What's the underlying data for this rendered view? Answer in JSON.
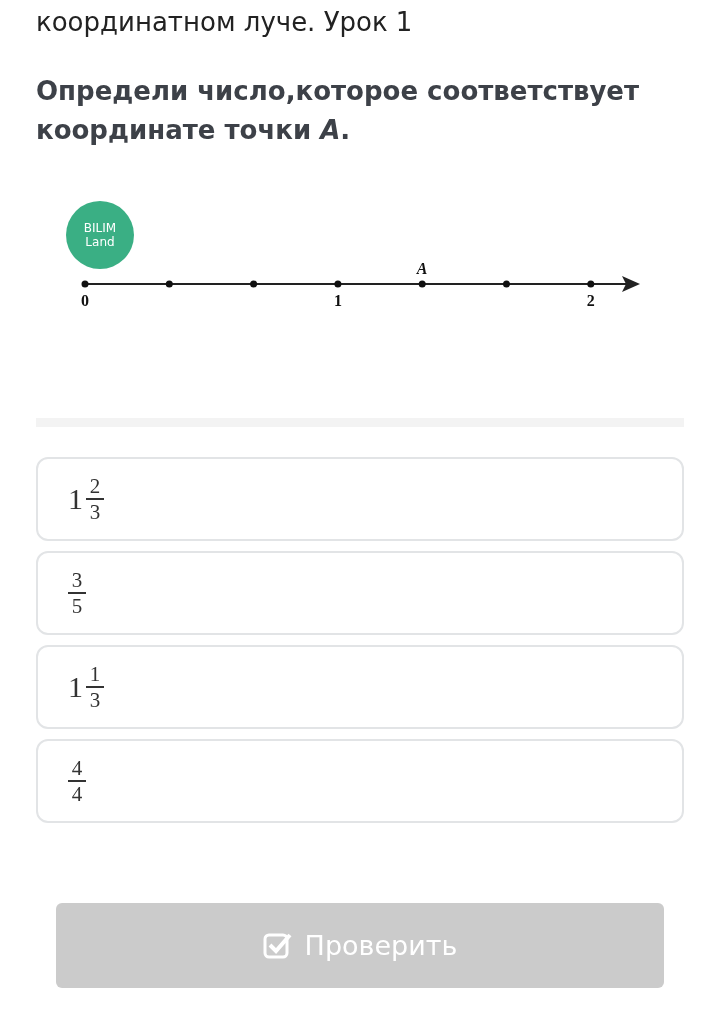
{
  "lesson_title": "координатном луче. Урок 1",
  "question": "Определи число,которое соответствует координате точки *A*.",
  "figure": {
    "logo": [
      "BILIM",
      "Land"
    ],
    "points": [
      {
        "kind": "below",
        "label": "0"
      },
      {
        "kind": "dot"
      },
      {
        "kind": "dot"
      },
      {
        "kind": "below",
        "label": "1"
      },
      {
        "kind": "above",
        "label": "A"
      },
      {
        "kind": "dot"
      },
      {
        "kind": "below",
        "label": "2"
      }
    ]
  },
  "options": [
    {
      "whole": "1",
      "numerator": "2",
      "denominator": "3",
      "selected": false
    },
    {
      "numerator": "3",
      "denominator": "5",
      "selected": false
    },
    {
      "whole": "1",
      "numerator": "1",
      "denominator": "3",
      "selected": false
    },
    {
      "numerator": "4",
      "denominator": "4",
      "selected": false
    }
  ],
  "check_button": {
    "label": "Проверить",
    "disabled": true
  }
}
